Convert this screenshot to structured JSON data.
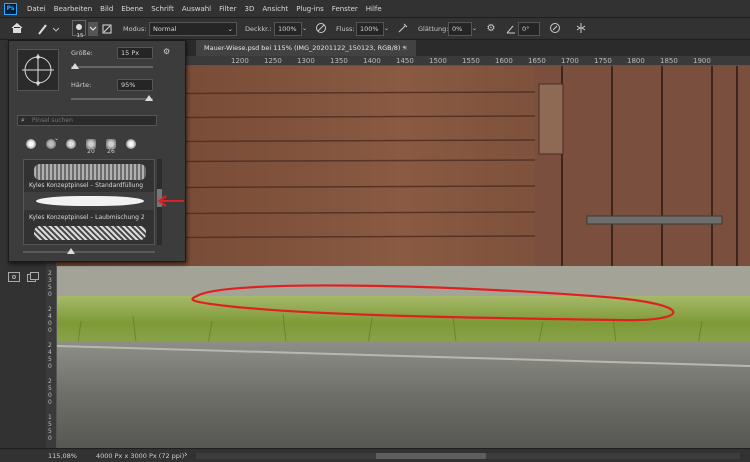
{
  "menu": {
    "logo": "Ps",
    "items": [
      "Datei",
      "Bearbeiten",
      "Bild",
      "Ebene",
      "Schrift",
      "Auswahl",
      "Filter",
      "3D",
      "Ansicht",
      "Plug-ins",
      "Fenster",
      "Hilfe"
    ]
  },
  "options": {
    "brush_size": "15",
    "modus_label": "Modus:",
    "modus_value": "Normal",
    "deckkraft_label": "Deckkr.:",
    "deckkraft_value": "100%",
    "fluss_label": "Fluss:",
    "fluss_value": "100%",
    "glaettung_label": "Glättung:",
    "glaettung_value": "0%",
    "angle_value": "0°"
  },
  "document": {
    "tab_title": "Mauer-Wiese.psd bei 115% (IMG_20201122_150123, RGB/8) *",
    "close": "×"
  },
  "ruler": {
    "h_ticks": [
      "1200",
      "1250",
      "1300",
      "1350",
      "1400",
      "1450",
      "1500",
      "1550",
      "1600",
      "1650",
      "1700",
      "1750",
      "1800",
      "1850",
      "1900"
    ],
    "v_ticks": [
      "2350",
      "2400",
      "2450",
      "2500",
      "1550"
    ]
  },
  "brush_panel": {
    "size_label": "Größe:",
    "size_value": "15 Px",
    "size_fraction": 0.05,
    "hardness_label": "Härte:",
    "hardness_value": "95%",
    "hardness_fraction": 0.95,
    "search_placeholder": "Pinsel suchen",
    "tips": [
      {
        "num": "",
        "color": "#ffffff"
      },
      {
        "num": "",
        "color": "#bdbdbd"
      },
      {
        "num": "",
        "color": "#e0e0e0"
      },
      {
        "num": "20",
        "color": "#cfcfcf"
      },
      {
        "num": "26",
        "color": "#cfcfcf"
      },
      {
        "num": "",
        "color": "#f5f5f5"
      }
    ],
    "list": [
      {
        "label": "Kyles Konzeptpinsel – Standardfüllung"
      },
      {
        "label": "Kyles Konzeptpinsel – Laubmischung 2"
      }
    ]
  },
  "status": {
    "zoom": "115,08%",
    "info": "4000 Px x 3000 Px (72 ppi)",
    "arrow": "›"
  },
  "colors": {
    "annotation": "#e02020",
    "accent": "#31a8ff"
  }
}
